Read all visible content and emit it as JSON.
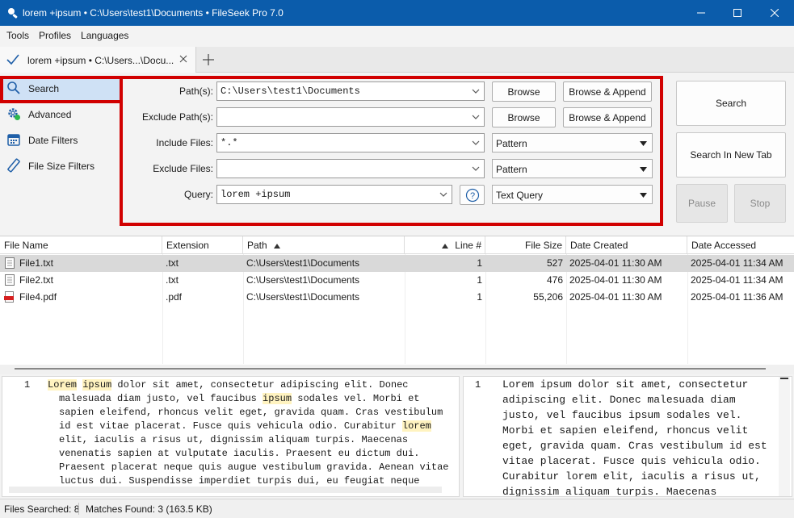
{
  "window": {
    "title": "lorem +ipsum • C:\\Users\\test1\\Documents • FileSeek Pro 7.0",
    "accent_color": "#0b5cab"
  },
  "menu": [
    "Tools",
    "Profiles",
    "Languages"
  ],
  "tabs": [
    {
      "label": "lorem +ipsum • C:\\Users...\\Docu..."
    }
  ],
  "sidebar": {
    "items": [
      {
        "label": "Search",
        "icon": "search-icon"
      },
      {
        "label": "Advanced",
        "icon": "advanced-gear-icon"
      },
      {
        "label": "Date Filters",
        "icon": "calendar-icon"
      },
      {
        "label": "File Size Filters",
        "icon": "ruler-icon"
      }
    ]
  },
  "form": {
    "paths": {
      "label": "Path(s):",
      "value": "C:\\Users\\test1\\Documents"
    },
    "exclude_paths": {
      "label": "Exclude Path(s):",
      "value": ""
    },
    "include_files": {
      "label": "Include Files:",
      "value": "*.*",
      "mode": "Pattern"
    },
    "exclude_files": {
      "label": "Exclude Files:",
      "value": "",
      "mode": "Pattern"
    },
    "query": {
      "label": "Query:",
      "value": "lorem +ipsum",
      "mode": "Text Query"
    },
    "browse_label": "Browse",
    "browse_append_label": "Browse & Append",
    "help_label": "?"
  },
  "actions": {
    "search": "Search",
    "search_new_tab": "Search In New Tab",
    "pause": "Pause",
    "stop": "Stop"
  },
  "results": {
    "columns": [
      "File Name",
      "Extension",
      "Path",
      "Line #",
      "File Size",
      "Date Created",
      "Date Accessed"
    ],
    "rows": [
      {
        "name": "File1.txt",
        "ext": ".txt",
        "path": "C:\\Users\\test1\\Documents",
        "line": "1",
        "size": "527",
        "created": "2025-04-01 11:30 AM",
        "accessed": "2025-04-01 11:34 AM",
        "icon": "text-file-icon"
      },
      {
        "name": "File2.txt",
        "ext": ".txt",
        "path": "C:\\Users\\test1\\Documents",
        "line": "1",
        "size": "476",
        "created": "2025-04-01 11:30 AM",
        "accessed": "2025-04-01 11:34 AM",
        "icon": "text-file-icon"
      },
      {
        "name": "File4.pdf",
        "ext": ".pdf",
        "path": "C:\\Users\\test1\\Documents",
        "line": "1",
        "size": "55,206",
        "created": "2025-04-01 11:30 AM",
        "accessed": "2025-04-01 11:36 AM",
        "icon": "pdf-file-icon"
      }
    ]
  },
  "preview_left": {
    "line_number": "1",
    "lines": [
      [
        [
          "Lorem",
          true
        ],
        [
          " ",
          false
        ],
        [
          "ipsum",
          true
        ],
        [
          " dolor sit amet, consectetur adipiscing elit. Donec",
          false
        ]
      ],
      [
        [
          "malesuada diam justo, vel faucibus ",
          false
        ],
        [
          "ipsum",
          true
        ],
        [
          " sodales vel. Morbi et",
          false
        ]
      ],
      [
        [
          "sapien eleifend, rhoncus velit eget, gravida quam. Cras vestibulum",
          false
        ]
      ],
      [
        [
          "id est vitae placerat. Fusce quis vehicula odio. Curabitur ",
          false
        ],
        [
          "lorem",
          true
        ]
      ],
      [
        [
          "elit, iaculis a risus ut, dignissim aliquam turpis. Maecenas",
          false
        ]
      ],
      [
        [
          "venenatis sapien at vulputate iaculis. Praesent eu dictum dui.",
          false
        ]
      ],
      [
        [
          "Praesent placerat neque quis augue vestibulum gravida. Aenean vitae",
          false
        ]
      ],
      [
        [
          "luctus dui. Suspendisse imperdiet turpis dui, eu feugiat neque",
          false
        ]
      ]
    ]
  },
  "preview_right": {
    "line_number": "1",
    "lines": [
      "Lorem ipsum dolor sit amet, consectetur",
      "adipiscing elit. Donec malesuada diam",
      "justo, vel faucibus ipsum sodales vel.",
      "Morbi et sapien eleifend, rhoncus velit",
      "eget, gravida quam. Cras vestibulum id est",
      "vitae placerat. Fusce quis vehicula odio.",
      "Curabitur lorem elit, iaculis a risus ut,",
      "dignissim aliquam turpis. Maecenas"
    ]
  },
  "status": {
    "files_searched": "Files Searched: 8",
    "matches_found": "Matches Found: 3 (163.5 KB)"
  }
}
